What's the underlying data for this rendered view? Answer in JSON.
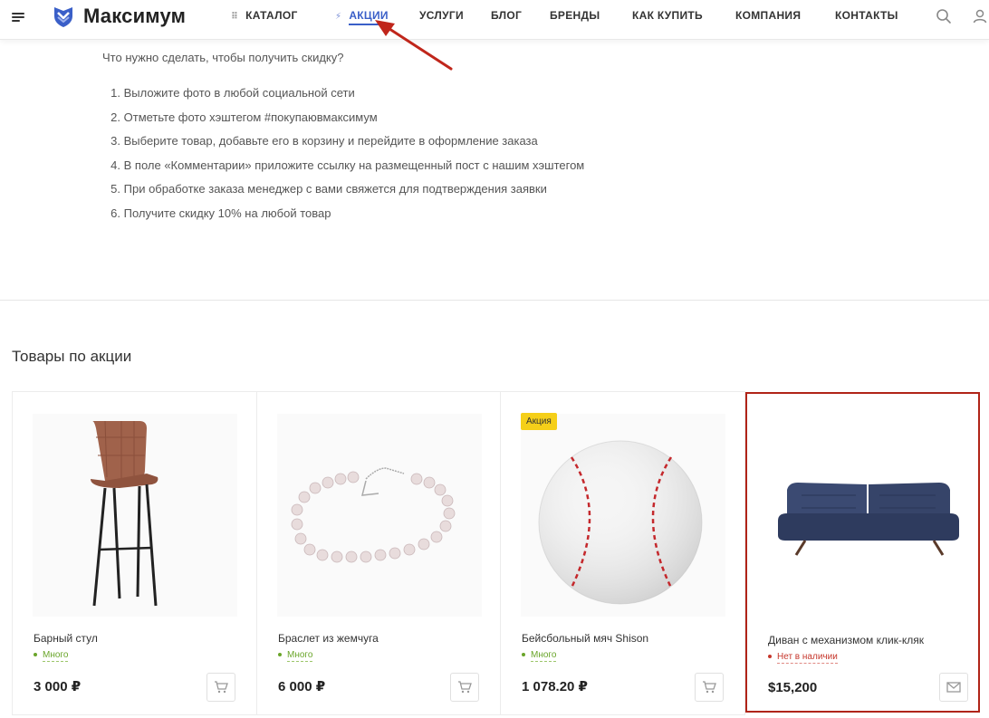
{
  "header": {
    "logo_text": "Максимум",
    "nav": [
      {
        "label": "КАТАЛОГ",
        "icon": "grid-icon"
      },
      {
        "label": "АКЦИИ",
        "icon": "lightning-icon",
        "active": true
      },
      {
        "label": "УСЛУГИ"
      },
      {
        "label": "БЛОГ"
      },
      {
        "label": "БРЕНДЫ"
      },
      {
        "label": "КАК КУПИТЬ"
      },
      {
        "label": "КОМПАНИЯ"
      },
      {
        "label": "КОНТАКТЫ"
      }
    ],
    "accent_color": "#3a5fc8"
  },
  "content": {
    "intro": "Что нужно сделать, чтобы получить скидку?",
    "steps": [
      "Выложите фото в любой социальной сети",
      "Отметьте фото хэштегом #покупаювмаксимум",
      "Выберите товар, добавьте его в корзину и перейдите в оформление заказа",
      "В поле «Комментарии» приложите ссылку на размещенный пост с нашим хэштегом",
      "При обработке заказа менеджер с вами свяжется для подтверждения заявки",
      "Получите скидку 10% на любой товар"
    ]
  },
  "products_section": {
    "title": "Товары по акции",
    "products": [
      {
        "name": "Барный стул",
        "stock": "Много",
        "price": "3 000 ₽",
        "action": "cart"
      },
      {
        "name": "Браслет из жемчуга",
        "stock": "Много",
        "price": "6 000 ₽",
        "action": "cart"
      },
      {
        "name": "Бейсбольный мяч Shison",
        "stock": "Много",
        "price": "1 078.20 ₽",
        "badge": "Акция",
        "action": "cart"
      },
      {
        "name": "Диван с механизмом клик-кляк",
        "stock": "Нет в наличии",
        "price": "$15,200",
        "action": "mail"
      }
    ]
  },
  "colors": {
    "in_stock": "#6aa52a",
    "out_of_stock": "#c6372c",
    "badge": "#f5cf19",
    "highlight_border": "#b02418",
    "arrow": "#c0261b"
  }
}
